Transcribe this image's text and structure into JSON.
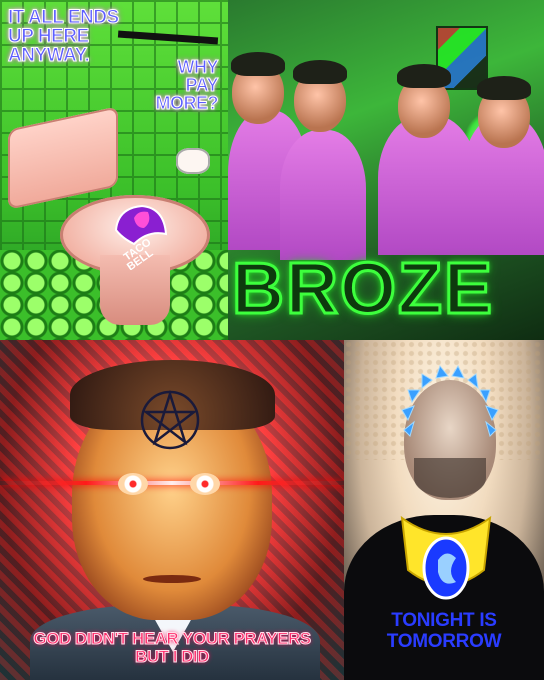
{
  "panel_top_left": {
    "caption_lines": [
      "IT ALL ENDS",
      "UP HERE",
      "ANYWAY."
    ],
    "side_caption_lines": [
      "WHY",
      "PAY",
      "MORE?"
    ],
    "logo_text": [
      "TACO",
      "BELL"
    ],
    "colors": {
      "caption_fill": "#5d5dff",
      "caption_outline": "#ffffff",
      "tile_green": "#3cc02a"
    }
  },
  "panel_top_right": {
    "title": "BROZE",
    "colors": {
      "title_outline": "#3dff3d",
      "shirt": "#d46ad8"
    }
  },
  "panel_bottom_left": {
    "caption_lines": [
      "GOD DIDN'T HEAR YOUR PRAYERS",
      "BUT I DID"
    ],
    "forehead_symbol": "pentagram",
    "colors": {
      "caption_fill": "#ff2a6a",
      "laser": "#ff1a1a"
    }
  },
  "panel_bottom_right": {
    "caption_lines": [
      "TONIGHT IS",
      "TOMORROW"
    ],
    "halo_color": "#3aa0ff",
    "necklace_colors": [
      "#ffe52a",
      "#1a3aff"
    ],
    "colors": {
      "caption_fill": "#2a3cff"
    }
  }
}
